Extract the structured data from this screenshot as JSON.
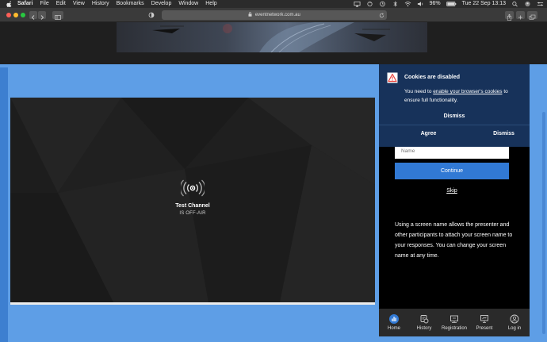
{
  "menubar": {
    "app_name": "Safari",
    "items": [
      "File",
      "Edit",
      "View",
      "History",
      "Bookmarks",
      "Develop",
      "Window",
      "Help"
    ],
    "battery": "96%",
    "clock": "Tue 22 Sep  13:13"
  },
  "browser": {
    "url": "eventnetwork.com.au"
  },
  "player": {
    "channel_title": "Test Channel",
    "status": "IS OFF-AIR"
  },
  "panel": {
    "name_placeholder": "Name",
    "continue_label": "Continue",
    "skip_label": "Skip",
    "info_text": "Using a screen name allows the presenter and other participants to attach your screen name to your responses. You can change your screen name at any time.",
    "tabs": [
      {
        "label": "Home",
        "icon": "bar-chart-icon"
      },
      {
        "label": "History",
        "icon": "history-icon"
      },
      {
        "label": "Registration",
        "icon": "registration-icon"
      },
      {
        "label": "Present",
        "icon": "present-icon"
      },
      {
        "label": "Log in",
        "icon": "user-icon"
      }
    ]
  },
  "cookie": {
    "title": "Cookies are disabled",
    "message_pre": "You need to ",
    "message_link": "enable your browser's cookies",
    "message_post": " to ensure full functionality.",
    "dismiss_top": "Dismiss",
    "agree": "Agree",
    "dismiss_bottom": "Dismiss"
  },
  "colors": {
    "page_blue": "#5e9ee6",
    "continue_blue": "#3179d4",
    "cookie_bg": "#17325a",
    "warning_red": "#e8403a"
  }
}
